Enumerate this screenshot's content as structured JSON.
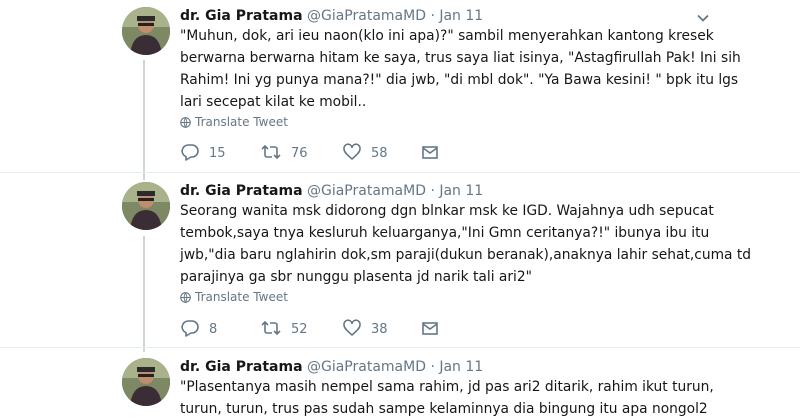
{
  "tweets": [
    {
      "name": "dr. Gia Pratama",
      "handle": "@GiaPratamaMD",
      "separator": "·",
      "date": "Jan 11",
      "lines": [
        "\"Muhun, dok, ari ieu naon(klo ini apa)?\" sambil menyerahkan kantong kresek",
        "berwarna berwarna hitam ke saya, trus saya liat isinya, \"Astagfirullah Pak! Ini sih",
        "Rahim! Ini yg punya mana?!\" dia jwb, \"di mbl dok\". \"Ya Bawa kesini! \" bpk itu lgs",
        "lari secepat kilat ke mobil.."
      ],
      "translate_label": "Translate Tweet",
      "replies": "15",
      "retweets": "76",
      "likes": "58"
    },
    {
      "name": "dr. Gia Pratama",
      "handle": "@GiaPratamaMD",
      "separator": "·",
      "date": "Jan 11",
      "lines": [
        "Seorang wanita msk didorong dgn blnkar msk ke IGD. Wajahnya udh sepucat",
        "tembok,saya tnya kesluruh keluarganya,\"Ini Gmn ceritanya?!\" ibunya ibu itu",
        "jwb,\"dia baru nglahirin dok,sm paraji(dukun beranak),anaknya lahir sehat,cuma td",
        "parajinya ga sbr nunggu plasenta jd narik tali ari2\""
      ],
      "translate_label": "Translate Tweet",
      "replies": "8",
      "retweets": "52",
      "likes": "38"
    },
    {
      "name": "dr. Gia Pratama",
      "handle": "@GiaPratamaMD",
      "separator": "·",
      "date": "Jan 11",
      "lines": [
        "\"Plasentanya masih nempel sama rahim, jd pas ari2 ditarik, rahim ikut turun,",
        "turun, turun, trus pas sudah sampe kelaminnya dia bingung itu apa nongol2"
      ]
    }
  ],
  "icons": {
    "reply": "reply-icon",
    "retweet": "retweet-icon",
    "like": "heart-icon",
    "message": "envelope-icon",
    "translate": "globe-icon",
    "caret": "chevron-down-icon"
  },
  "colors": {
    "text": "#14171a",
    "secondary": "#657786",
    "thread_line": "#ccd6dd",
    "divider": "#e6ecf0"
  }
}
